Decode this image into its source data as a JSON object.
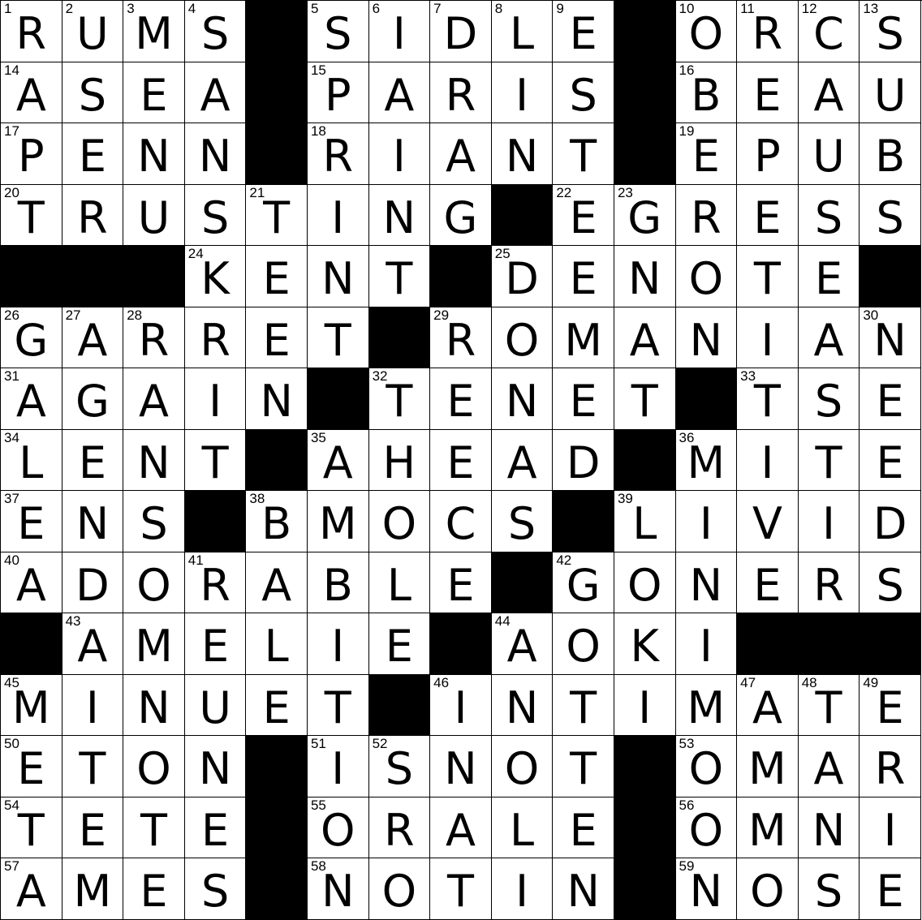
{
  "puzzle": {
    "rows": [
      "RUMS#SIDLE#ORCS",
      "ASEA#PARIS#BEAU",
      "PENN#RIANT#EPUB",
      "TRUSTING#EGRESS",
      "###KENT#DENOTE#",
      "GARRET#ROMANIAN",
      "AGAIN#TENET#TSE",
      "LENT#AHEAD#MITE",
      "ENS#BMOCS#LIVID",
      "ADORABLE#GONERS",
      "#AMELIE#AOKI###",
      "MINUET#INTIMATE",
      "ETON#ISNOT#OMAR",
      "TETE#ORALE#OMNI",
      "AMES#NOTIN#NOSE"
    ],
    "numbers": [
      [
        1,
        2,
        3,
        4,
        0,
        5,
        6,
        7,
        8,
        9,
        0,
        10,
        11,
        12,
        13
      ],
      [
        14,
        0,
        0,
        0,
        0,
        15,
        0,
        0,
        0,
        0,
        0,
        16,
        0,
        0,
        0
      ],
      [
        17,
        0,
        0,
        0,
        0,
        18,
        0,
        0,
        0,
        0,
        0,
        19,
        0,
        0,
        0
      ],
      [
        20,
        0,
        0,
        0,
        21,
        0,
        0,
        0,
        0,
        22,
        23,
        0,
        0,
        0,
        0
      ],
      [
        0,
        0,
        0,
        24,
        0,
        0,
        0,
        0,
        25,
        0,
        0,
        0,
        0,
        0,
        0
      ],
      [
        26,
        27,
        28,
        0,
        0,
        0,
        0,
        29,
        0,
        0,
        0,
        0,
        0,
        0,
        30
      ],
      [
        31,
        0,
        0,
        0,
        0,
        0,
        32,
        0,
        0,
        0,
        0,
        0,
        33,
        0,
        0
      ],
      [
        34,
        0,
        0,
        0,
        0,
        35,
        0,
        0,
        0,
        0,
        0,
        36,
        0,
        0,
        0
      ],
      [
        37,
        0,
        0,
        0,
        38,
        0,
        0,
        0,
        0,
        0,
        39,
        0,
        0,
        0,
        0
      ],
      [
        40,
        0,
        0,
        41,
        0,
        0,
        0,
        0,
        0,
        42,
        0,
        0,
        0,
        0,
        0
      ],
      [
        0,
        43,
        0,
        0,
        0,
        0,
        0,
        0,
        44,
        0,
        0,
        0,
        0,
        0,
        0
      ],
      [
        45,
        0,
        0,
        0,
        0,
        0,
        0,
        46,
        0,
        0,
        0,
        0,
        47,
        48,
        49
      ],
      [
        50,
        0,
        0,
        0,
        0,
        51,
        52,
        0,
        0,
        0,
        0,
        53,
        0,
        0,
        0
      ],
      [
        54,
        0,
        0,
        0,
        0,
        55,
        0,
        0,
        0,
        0,
        0,
        56,
        0,
        0,
        0
      ],
      [
        57,
        0,
        0,
        0,
        0,
        58,
        0,
        0,
        0,
        0,
        0,
        59,
        0,
        0,
        0
      ]
    ]
  }
}
